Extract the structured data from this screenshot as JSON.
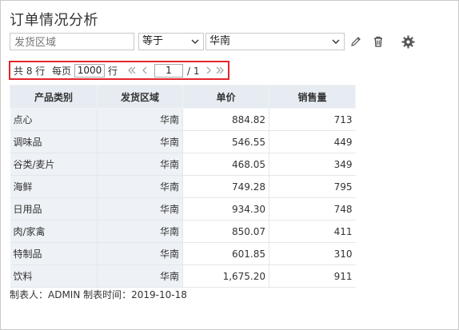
{
  "title": "订单情况分析",
  "filter": {
    "field_placeholder": "发货区域",
    "operator": "等于",
    "value": "华南"
  },
  "icons": {
    "edit": "pencil-icon",
    "delete": "trash-icon",
    "settings": "gear-icon"
  },
  "pager": {
    "total_label": "共 8 行",
    "per_page_label": "每页",
    "per_page_value": "1000",
    "rows_unit": "行",
    "current_page": "1",
    "page_total": "/ 1"
  },
  "table": {
    "headers": [
      "产品类别",
      "发货区域",
      "单价",
      "销售量"
    ],
    "rows": [
      [
        "点心",
        "华南",
        "884.82",
        "713"
      ],
      [
        "调味品",
        "华南",
        "546.55",
        "449"
      ],
      [
        "谷类/麦片",
        "华南",
        "468.05",
        "349"
      ],
      [
        "海鲜",
        "华南",
        "749.28",
        "795"
      ],
      [
        "日用品",
        "华南",
        "934.30",
        "748"
      ],
      [
        "肉/家禽",
        "华南",
        "850.07",
        "411"
      ],
      [
        "特制品",
        "华南",
        "601.85",
        "310"
      ],
      [
        "饮料",
        "华南",
        "1,675.20",
        "911"
      ]
    ]
  },
  "footer": "制表人：ADMIN  制表时间：2019-10-18",
  "colors": {
    "highlight_border": "#e2262b",
    "header_bg": "#e6ecf1",
    "dimension_bg": "#eef2f6"
  }
}
